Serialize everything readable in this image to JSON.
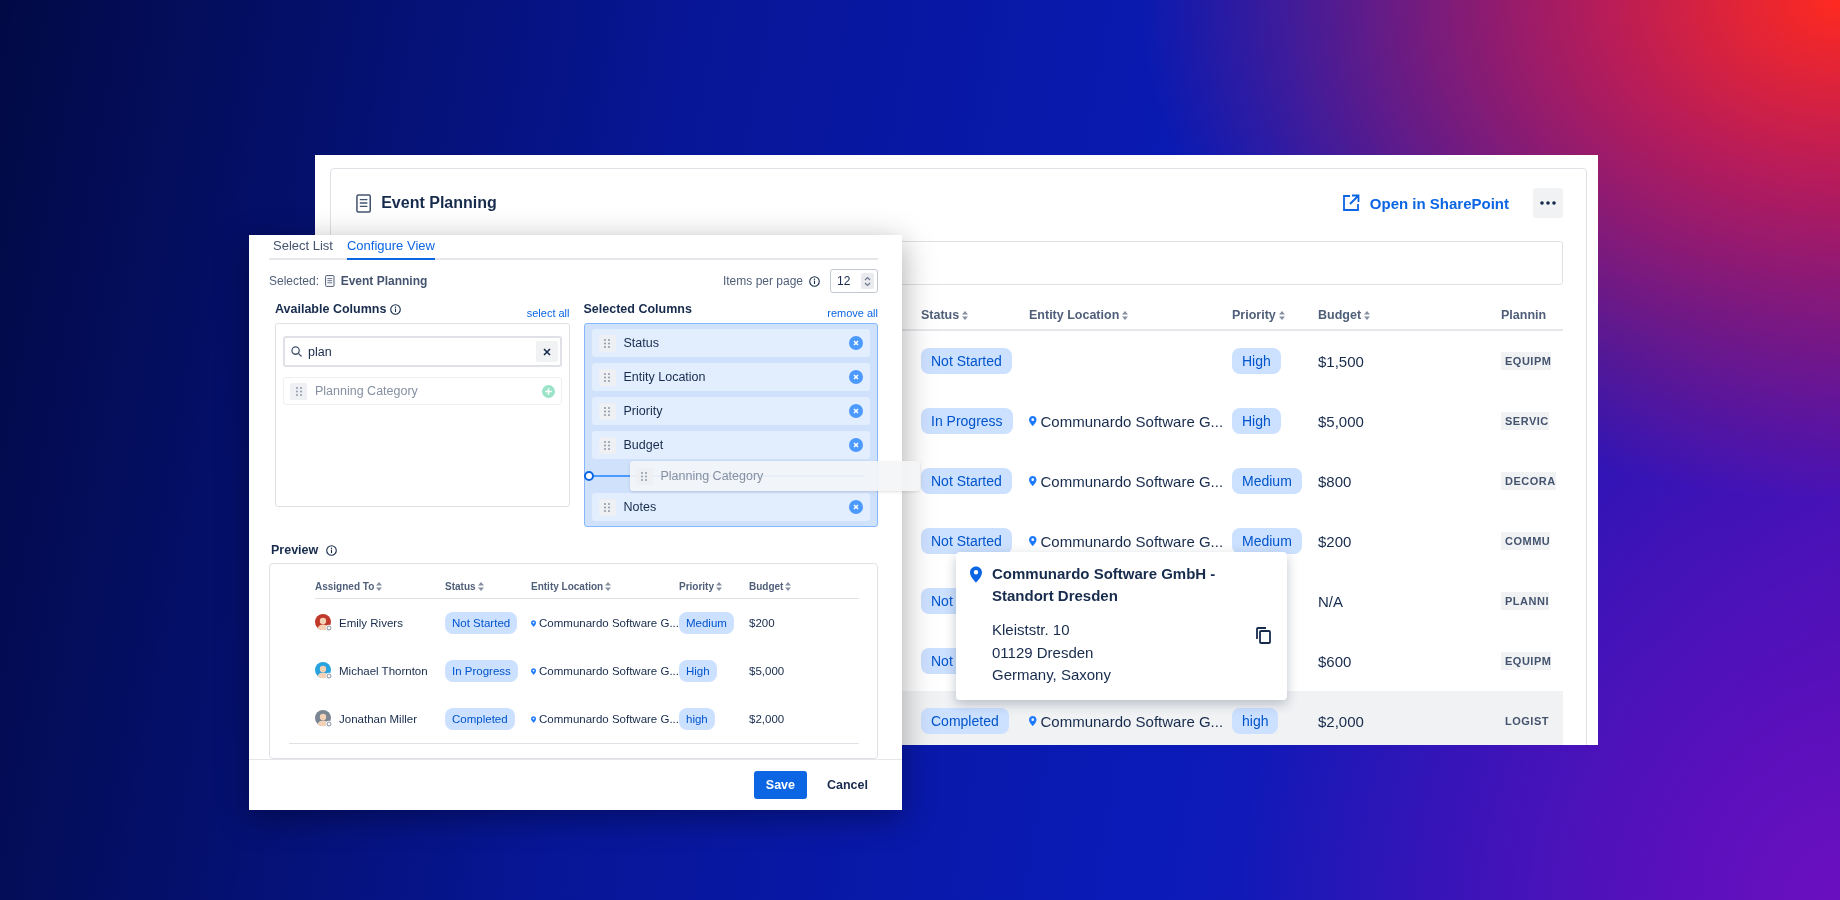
{
  "main_window": {
    "title": "Event Planning",
    "open_link": "Open in SharePoint",
    "table": {
      "columns": [
        "Status",
        "Entity Location",
        "Priority",
        "Budget",
        "Plannin"
      ],
      "rows": [
        {
          "status": "Not Started",
          "priority": "High",
          "budget": "$1,500",
          "category": "EQUIPM",
          "highlighted": false
        },
        {
          "status": "In Progress",
          "location": "Communardo Software G...",
          "priority": "High",
          "budget": "$5,000",
          "category": "SERVIC",
          "highlighted": false
        },
        {
          "status": "Not Started",
          "location": "Communardo Software G...",
          "priority": "Medium",
          "budget": "$800",
          "category": "DECORA",
          "highlighted": false
        },
        {
          "status": "Not Started",
          "location": "Communardo Software G...",
          "priority": "Medium",
          "budget": "$200",
          "category": "COMMU",
          "highlighted": false
        },
        {
          "status": "Not",
          "budget": "N/A",
          "category": "PLANNI",
          "highlighted": false
        },
        {
          "status": "Not",
          "budget": "$600",
          "category": "EQUIPM",
          "highlighted": false
        },
        {
          "status": "Completed",
          "location": "Communardo Software G...",
          "priority": "high",
          "budget": "$2,000",
          "category": "LOGIST",
          "highlighted": true
        }
      ]
    }
  },
  "location_popover": {
    "title": "Communardo Software GmbH - Standort Dresden",
    "address": [
      "Kleiststr. 10",
      "01129 Dresden",
      "Germany, Saxony"
    ]
  },
  "dialog": {
    "tabs": [
      {
        "label": "Select List",
        "selected": false
      },
      {
        "label": "Configure View",
        "selected": true
      }
    ],
    "selected_label": "Selected:",
    "selected_list": "Event Planning",
    "items_per_page": {
      "label": "Items per page",
      "value": "12"
    },
    "available": {
      "title": "Available Columns",
      "action": "select all",
      "search": {
        "value": "plan"
      },
      "items": [
        {
          "label": "Planning Category",
          "dragging": true
        }
      ]
    },
    "selected_columns": {
      "title": "Selected Columns",
      "action": "remove all",
      "items": [
        {
          "label": "Status",
          "drop_target": false
        },
        {
          "label": "Entity Location",
          "drop_target": false
        },
        {
          "label": "Priority",
          "drop_target": false
        },
        {
          "label": "Budget",
          "drop_target": false
        },
        {
          "label": "Notes",
          "drop_target": true
        }
      ],
      "drag_ghost": {
        "label": "Planning Category"
      }
    },
    "preview": {
      "title": "Preview",
      "columns": [
        "Assigned To",
        "Status",
        "Entity Location",
        "Priority",
        "Budget"
      ],
      "rows": [
        {
          "assigned_to": "Emily Rivers",
          "color": "#c0392b",
          "status": "Not Started",
          "location": "Communardo Software G...",
          "priority": "Medium",
          "budget": "$200"
        },
        {
          "assigned_to": "Michael Thornton",
          "color": "#29a3e0",
          "status": "In Progress",
          "location": "Communardo Software G...",
          "priority": "High",
          "budget": "$5,000"
        },
        {
          "assigned_to": "Jonathan Miller",
          "color": "#7a8694",
          "status": "Completed",
          "location": "Communardo Software G...",
          "priority": "high",
          "budget": "$2,000"
        }
      ]
    },
    "buttons": [
      {
        "label": "Save",
        "kind": "primary"
      },
      {
        "label": "Cancel",
        "kind": "secondary"
      }
    ]
  }
}
